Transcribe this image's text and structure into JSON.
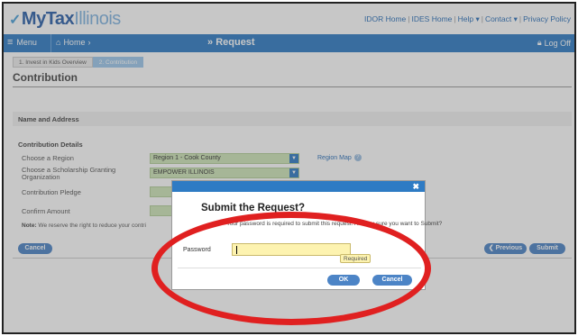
{
  "header": {
    "logo_my": "My",
    "logo_tax": "Tax",
    "logo_state": "Illinois",
    "links": {
      "idor_home": "IDOR Home",
      "ides_home": "IDES Home",
      "help": "Help",
      "contact": "Contact",
      "privacy": "Privacy Policy"
    }
  },
  "navbar": {
    "menu_label": "Menu",
    "home_label": "Home",
    "title": "Request",
    "logoff_label": "Log Off",
    "accent": "#2e7bc4"
  },
  "breadcrumb": {
    "steps": [
      "1. Invest in Kids Overview",
      "2. Contribution"
    ]
  },
  "page": {
    "title": "Contribution",
    "name_address_label": "Name and Address",
    "contribution_details_label": "Contribution Details",
    "choose_region_label": "Choose a Region",
    "region_value": "Region 1 - Cook County",
    "region_map_link": "Region Map",
    "choose_sgo_label": "Choose a Scholarship Granting Organization",
    "sgo_value": "EMPOWER ILLINOIS",
    "pledge_label": "Contribution Pledge",
    "confirm_label": "Confirm Amount",
    "note_prefix": "Note:",
    "note_text": "We reserve the right to reduce your contri",
    "cancel_button": "Cancel",
    "previous_button": "Previous",
    "submit_button": "Submit"
  },
  "modal": {
    "title": "Submit the Request?",
    "message": "Your password is required to submit this request. Are you sure you want to Submit?",
    "password_label": "Password",
    "password_value": "",
    "required_badge": "Required",
    "ok_button": "OK",
    "cancel_button": "Cancel",
    "close_icon": "close-icon"
  },
  "annotation_color": "#e02020"
}
